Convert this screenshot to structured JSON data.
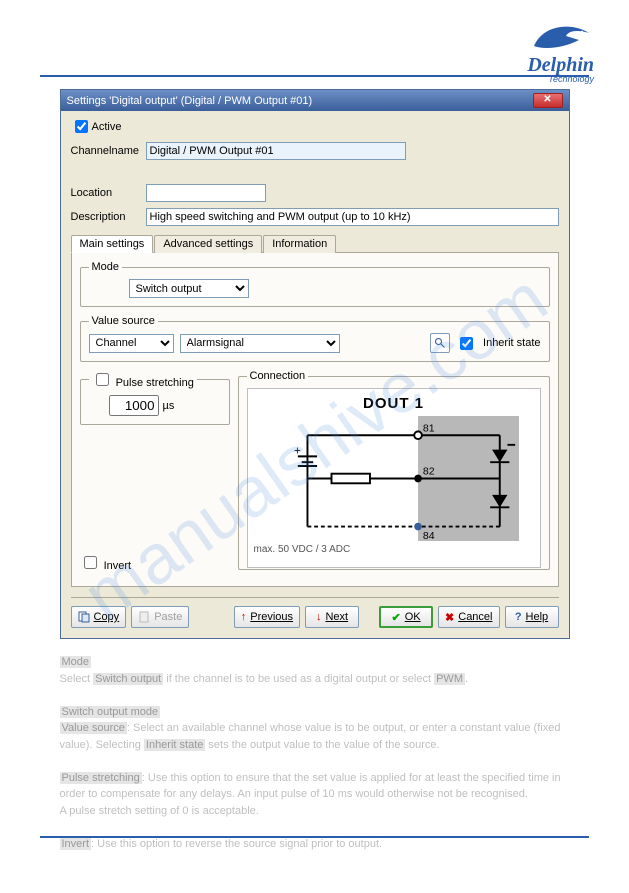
{
  "logo": {
    "brand": "Delphin",
    "sub": "Technology"
  },
  "titlebar": "Settings 'Digital output' (Digital / PWM Output #01)",
  "fields": {
    "active_label": "Active",
    "channelname_label": "Channelname",
    "channelname_value": "Digital / PWM Output #01",
    "location_label": "Location",
    "location_value": "",
    "description_label": "Description",
    "description_value": "High speed switching and PWM output (up to 10 kHz)"
  },
  "tabs": {
    "main": "Main settings",
    "advanced": "Advanced settings",
    "info": "Information"
  },
  "mode": {
    "legend": "Mode",
    "value": "Switch output"
  },
  "source": {
    "legend": "Value source",
    "channel_label": "Channel",
    "channel_value": "Alarmsignal",
    "inherit_label": "Inherit state"
  },
  "pulse": {
    "label": "Pulse stretching",
    "value": "1000",
    "unit": "µs"
  },
  "connection": {
    "legend": "Connection",
    "title": "DOUT 1",
    "t81": "81",
    "t82": "82",
    "t84": "84",
    "caption": "max. 50 VDC / 3 ADC"
  },
  "invert_label": "Invert",
  "buttons": {
    "copy": "Copy",
    "paste": "Paste",
    "previous": "Previous",
    "next": "Next",
    "ok": "OK",
    "cancel": "Cancel",
    "help": "Help"
  },
  "para": {
    "lines": [
      "Mode",
      "Switch output",
      "PWM",
      "Switch output mode",
      "Value source",
      "Inherit state",
      "Pulse stretching",
      "Invert"
    ]
  },
  "watermark": "manualshive.com"
}
